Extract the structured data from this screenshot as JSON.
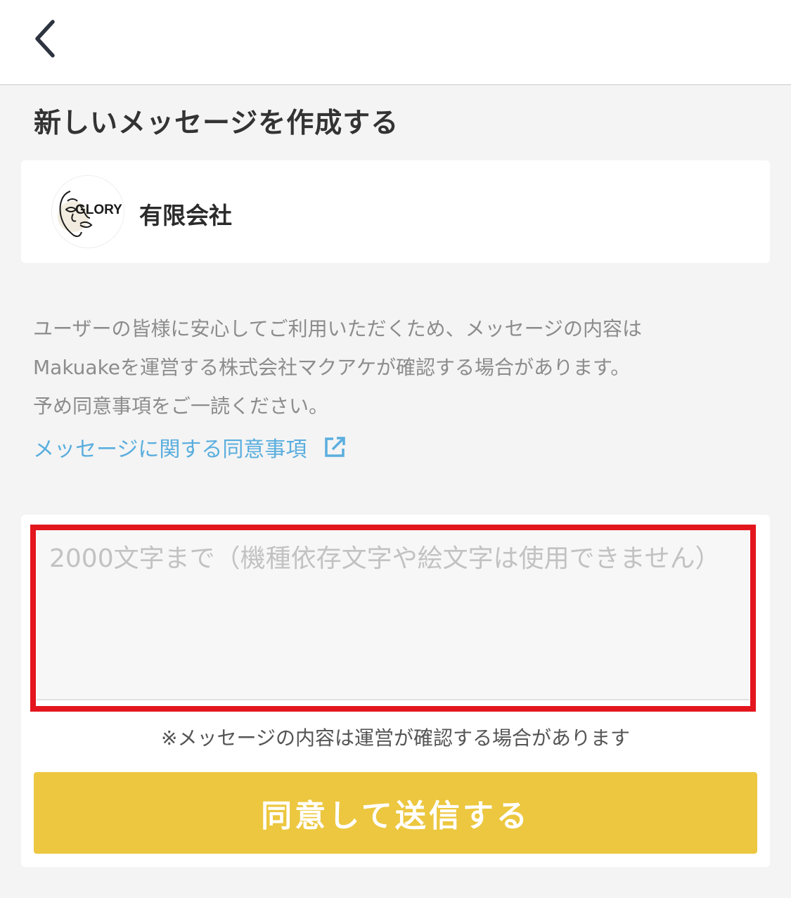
{
  "header": {
    "back_icon": "chevron-left-icon"
  },
  "page": {
    "title": "新しいメッセージを作成する"
  },
  "company": {
    "logo_text": "GLORY",
    "name": "有限会社"
  },
  "notice": {
    "lines": [
      "ユーザーの皆様に安心してご利用いただくため、メッセージの内容は",
      "Makuakeを運営する株式会社マクアケが確認する場合があります。",
      "予め同意事項をご一読ください。"
    ],
    "link_label": "メッセージに関する同意事項",
    "link_icon": "external-link-icon"
  },
  "form": {
    "placeholder": "2000文字まで（機種依存文字や絵文字は使用できません）",
    "value": "",
    "note": "※メッセージの内容は運営が確認する場合があります",
    "submit_label": "同意して送信する"
  },
  "colors": {
    "accent_button": "#ecc73f",
    "link": "#5aaede",
    "highlight_border": "#e3161e"
  }
}
